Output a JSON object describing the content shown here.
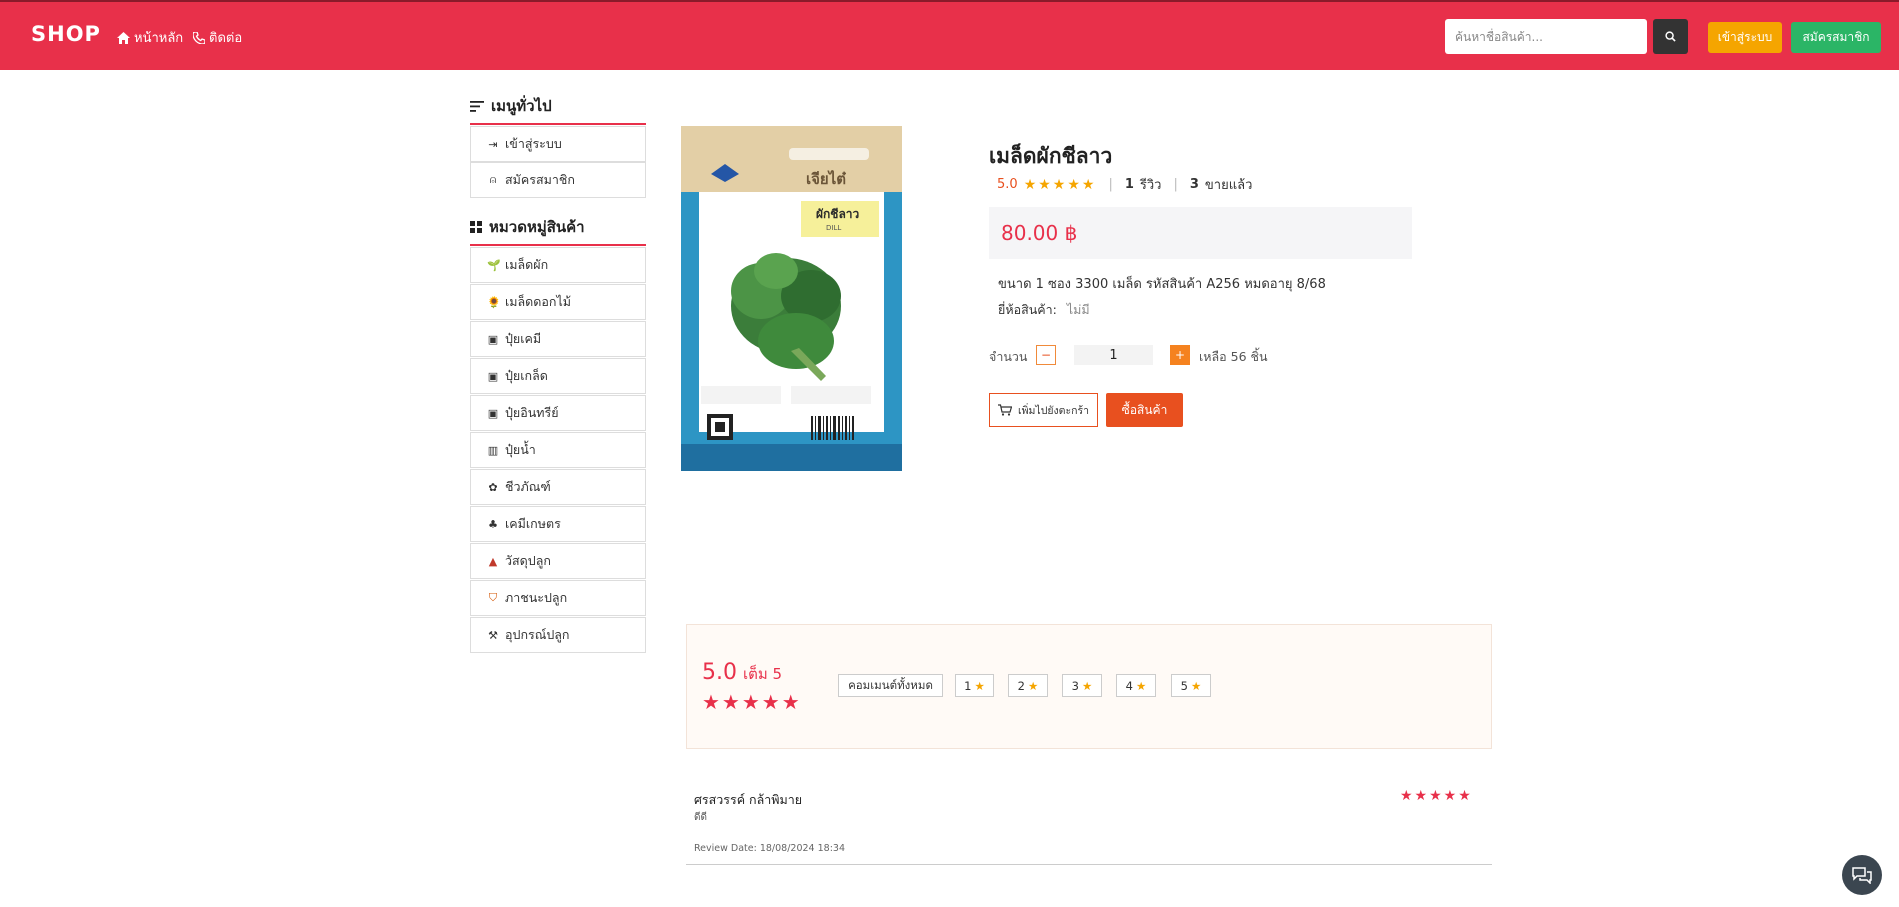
{
  "header": {
    "brand": "SHOP",
    "nav": [
      {
        "label": "หน้าหลัก",
        "icon": "home-icon"
      },
      {
        "label": "ติดต่อ",
        "icon": "phone-icon"
      }
    ],
    "search": {
      "placeholder": "ค้นหาชื่อสินค้า...",
      "value": ""
    },
    "login_label": "เข้าสู่ระบบ",
    "register_label": "สมัครสมาชิก",
    "colors": {
      "bar": "#e8304a",
      "login": "#f5a500",
      "register": "#2bb566"
    }
  },
  "sidebar": {
    "general_title": "เมนูทั่วไป",
    "general_items": [
      {
        "label": "เข้าสู่ระบบ",
        "icon": "login-icon"
      },
      {
        "label": "สมัครสมาชิก",
        "icon": "user-plus-icon"
      }
    ],
    "category_title": "หมวดหมู่สินค้า",
    "categories": [
      {
        "label": "เมล็ดผัก",
        "icon": "seed-icon"
      },
      {
        "label": "เมล็ดดอกไม้",
        "icon": "flower-icon"
      },
      {
        "label": "ปุ๋ยเคมี",
        "icon": "fertilizer-bag-icon"
      },
      {
        "label": "ปุ๋ยเกล็ด",
        "icon": "fertilizer-flake-icon"
      },
      {
        "label": "ปุ๋ยอินทรีย์",
        "icon": "organic-fertilizer-icon"
      },
      {
        "label": "ปุ๋ยน้ำ",
        "icon": "liquid-fertilizer-icon"
      },
      {
        "label": "ชีวภัณฑ์",
        "icon": "bio-product-icon"
      },
      {
        "label": "เคมีเกษตร",
        "icon": "agrochemical-icon"
      },
      {
        "label": "วัสดุปลูก",
        "icon": "soil-icon"
      },
      {
        "label": "ภาชนะปลูก",
        "icon": "pot-icon"
      },
      {
        "label": "อุปกรณ์ปลูก",
        "icon": "garden-tool-icon"
      }
    ]
  },
  "product": {
    "title": "เมล็ดผักชีลาว",
    "rating": "5.0",
    "rating_value": 5,
    "review_count": "1",
    "review_word": "รีวิว",
    "sold_count": "3",
    "sold_word": "ขายแล้ว",
    "price": "80.00 ฿",
    "description": "ขนาด 1 ซอง 3300 เมล็ด รหัสสินค้า A256 หมดอายุ 8/68",
    "brand_label": "ยี่ห้อสินค้า:",
    "brand_value": "ไม่มี",
    "qty_label": "จำนวน",
    "qty_value": "1",
    "stock_text": "เหลือ 56 ชิ้น",
    "add_to_cart": "เพิ่มไปยังตะกร้า",
    "buy_now": "ซื้อสินค้า",
    "image": {
      "brand_text": "เจียไต๋",
      "name_th": "ผักชีลาว",
      "name_en": "DILL"
    }
  },
  "reviews": {
    "average": "5.0",
    "out_of": "เต็ม 5",
    "average_stars": 5,
    "filter_all": "คอมเมนต์ทั้งหมด",
    "filters": [
      "1",
      "2",
      "3",
      "4",
      "5"
    ],
    "items": [
      {
        "name": "ศรสวรรค์ กล้าพิมาย",
        "comment": "ดีดี",
        "date": "Review Date: 18/08/2024 18:34",
        "stars": 5
      }
    ]
  }
}
